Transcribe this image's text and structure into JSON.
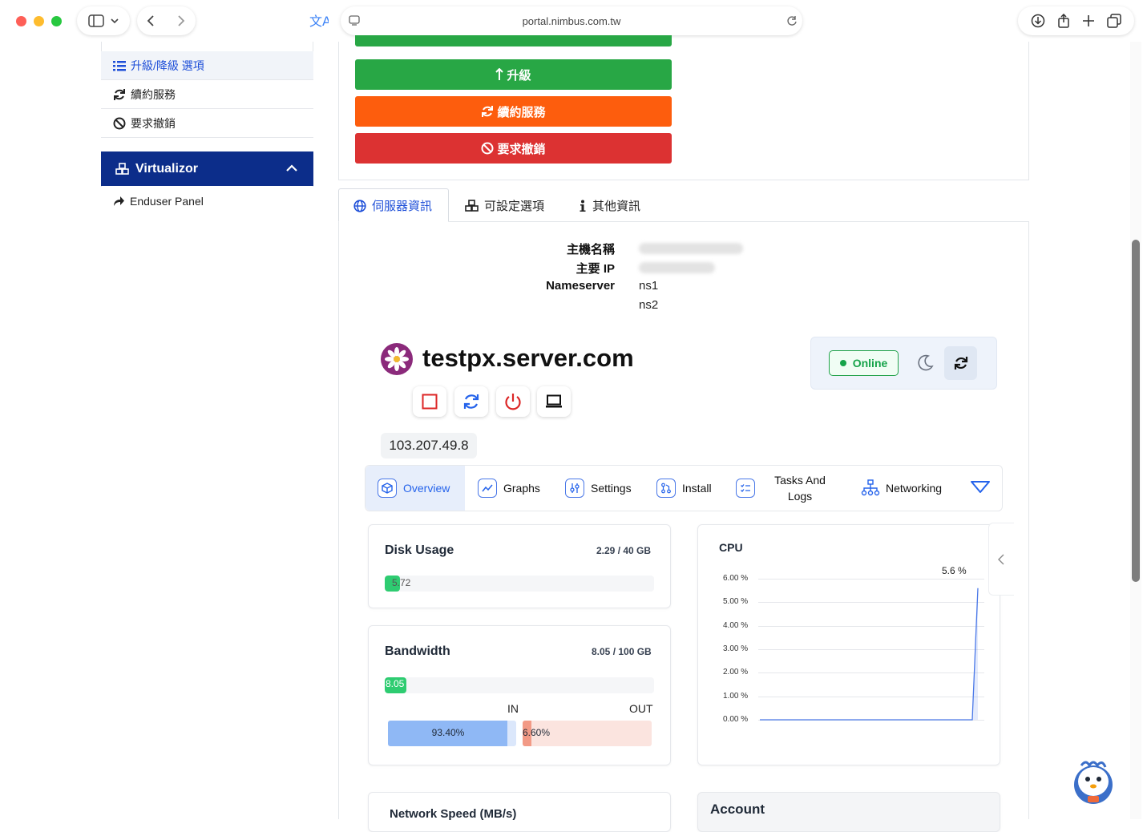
{
  "browser": {
    "url": "portal.nimbus.com.tw"
  },
  "sidebar": {
    "items": [
      {
        "label": "升級/降級 選項",
        "icon": "list-icon",
        "active": true
      },
      {
        "label": "續約服務",
        "icon": "refresh-icon",
        "active": false
      },
      {
        "label": "要求撤銷",
        "icon": "ban-icon",
        "active": false
      }
    ],
    "virtualizor": {
      "title": "Virtualizor",
      "items": [
        {
          "label": "Enduser Panel",
          "icon": "share-icon"
        }
      ]
    }
  },
  "actions": {
    "upgrade": "升級",
    "renew": "續約服務",
    "cancel": "要求撤銷"
  },
  "tabs": [
    {
      "label": "伺服器資訊",
      "icon": "globe-icon",
      "active": true
    },
    {
      "label": "可設定選項",
      "icon": "cubes-icon",
      "active": false
    },
    {
      "label": "其他資訊",
      "icon": "info-icon",
      "active": false
    }
  ],
  "server_info": {
    "hostname_label": "主機名稱",
    "ip_label": "主要 IP",
    "nameserver_label": "Nameserver",
    "ns1": "ns1",
    "ns2": "ns2"
  },
  "vps": {
    "hostname": "testpx.server.com",
    "status": "Online",
    "ip": "103.207.49.8",
    "nav": [
      {
        "label": "Overview",
        "icon": "box-icon",
        "active": true
      },
      {
        "label": "Graphs",
        "icon": "graph-icon",
        "active": false
      },
      {
        "label": "Settings",
        "icon": "settings-icon",
        "active": false
      },
      {
        "label": "Install",
        "icon": "install-icon",
        "active": false
      },
      {
        "label": "Tasks And Logs",
        "icon": "tasks-icon",
        "active": false
      },
      {
        "label": "Networking",
        "icon": "network-icon",
        "active": false
      }
    ],
    "disk": {
      "title": "Disk Usage",
      "usage": "2.29 / 40 GB",
      "percent_label": "5.72",
      "percent": 5.72
    },
    "bandwidth": {
      "title": "Bandwidth",
      "usage": "8.05 / 100 GB",
      "percent_label": "8.05",
      "percent": 8.05,
      "in_label": "IN",
      "out_label": "OUT",
      "in_percent": "93.40%",
      "out_percent": "6.60%",
      "in_value": 93.4,
      "out_value": 6.6
    },
    "network_speed_title": "Network Speed (MB/s)",
    "account_title": "Account"
  },
  "chart_data": {
    "type": "line",
    "title": "CPU",
    "ylabel": "",
    "yticks": [
      "6.00 %",
      "5.00 %",
      "4.00 %",
      "3.00 %",
      "2.00 %",
      "1.00 %",
      "0.00 %"
    ],
    "ylim": [
      0,
      6
    ],
    "series": [
      {
        "values": [
          0,
          0,
          0,
          0,
          0,
          0,
          0,
          0,
          0,
          0,
          0,
          0,
          0,
          0,
          0,
          0,
          0,
          0,
          0,
          0,
          0,
          0,
          0,
          0,
          0,
          0,
          0,
          0,
          0,
          0,
          5.6
        ]
      }
    ],
    "annotation": "5.6 %",
    "grid": true,
    "color": "#4a78e8"
  },
  "colors": {
    "primary": "#0c2d8a",
    "green": "#28a745",
    "orange": "#fd5d0d",
    "red": "#dc3232",
    "link_blue": "#1d4ed8"
  }
}
